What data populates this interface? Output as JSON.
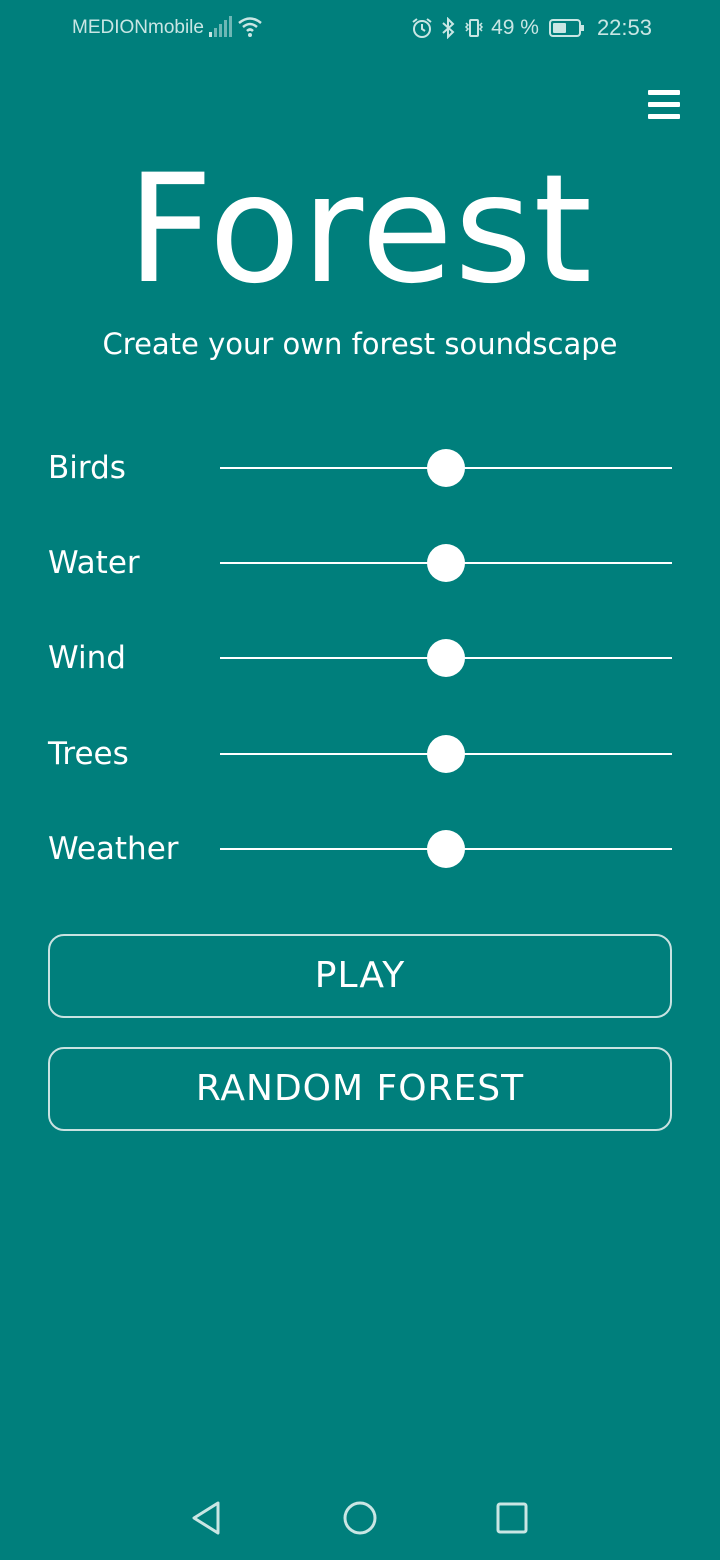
{
  "status_bar": {
    "carrier": "MEDIONmobile",
    "battery_percent": "49 %",
    "time": "22:53",
    "icons": [
      "signal-icon",
      "wifi-icon",
      "alarm-icon",
      "bluetooth-icon",
      "vibrate-icon",
      "battery-icon"
    ]
  },
  "header": {
    "menu_icon": "hamburger-menu-icon"
  },
  "main": {
    "title": "Forest",
    "subtitle": "Create your own forest soundscape",
    "sliders": [
      {
        "label": "Birds",
        "value": 0.5
      },
      {
        "label": "Water",
        "value": 0.5
      },
      {
        "label": "Wind",
        "value": 0.5
      },
      {
        "label": "Trees",
        "value": 0.5
      },
      {
        "label": "Weather",
        "value": 0.5
      }
    ],
    "play_label": "PLAY",
    "random_label": "RANDOM FOREST"
  },
  "nav_bar": {
    "icons": [
      "back-icon",
      "home-icon",
      "recents-icon"
    ]
  },
  "colors": {
    "background": "#007f7c",
    "foreground": "#ffffff",
    "status_text": "#c9e6e4"
  }
}
